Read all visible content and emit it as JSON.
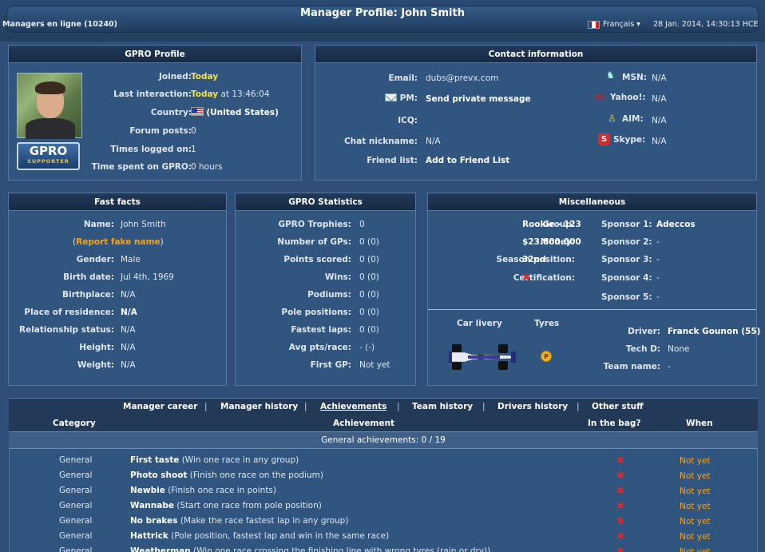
{
  "header": {
    "title": "Manager Profile: John Smith",
    "online": "Managers en ligne (10240)",
    "language": "Français ▾",
    "datetime": "28 Jan. 2014, 14:30:13 HCE",
    "colors": {
      "accent": "#f4e24a",
      "link": "#f6a21a",
      "bg": "#2f4f78"
    }
  },
  "profile": {
    "heading": "GPRO Profile",
    "badge_line1": "GPRO",
    "badge_line2": "SUPPORTER",
    "joined_label": "Joined:",
    "joined": "Today",
    "last_label": "Last interaction:",
    "last_day": "Today",
    "last_time": " at 13:46:04",
    "country_label": "Country:",
    "country": "(United States)",
    "posts_label": "Forum posts:",
    "posts": "0",
    "logged_label": "Times logged on:",
    "logged": "1",
    "spent_label": "Time spent on GPRO:",
    "spent": "0 hours"
  },
  "contact": {
    "heading": "Contact information",
    "email_label": "Email:",
    "email": "dubs@prevx.com",
    "pm_label": "PM:",
    "pm": "Send private message",
    "icq_label": "ICQ:",
    "icq": "",
    "chat_label": "Chat nickname:",
    "chat": "N/A",
    "friend_label": "Friend list:",
    "friend": "Add to Friend List",
    "msn_label": "MSN:",
    "msn": "N/A",
    "yahoo_label": "Yahoo!:",
    "yahoo": "N/A",
    "aim_label": "AIM:",
    "aim": "N/A",
    "skype_label": "Skype:",
    "skype": "N/A"
  },
  "facts": {
    "heading": "Fast facts",
    "name_label": "Name:",
    "name": "John Smith",
    "report_open": "(",
    "report": "Report fake name",
    "report_close": ")",
    "gender_label": "Gender:",
    "gender": "Male",
    "birth_label": "Birth date:",
    "birth": "Jul 4th, 1969",
    "birthplace_label": "Birthplace:",
    "birthplace": "N/A",
    "residence_label": "Place of residence:",
    "residence": "N/A",
    "relation_label": "Relationship status:",
    "relation": "N/A",
    "height_label": "Height:",
    "height": "N/A",
    "weight_label": "Weight:",
    "weight": "N/A"
  },
  "stats": {
    "heading": "GPRO Statistics",
    "trophies_label": "GPRO Trophies:",
    "trophies": "0",
    "gps_label": "Number of GPs:",
    "gps": "0 (0)",
    "points_label": "Points scored:",
    "points": "0 (0)",
    "wins_label": "Wins:",
    "wins": "0 (0)",
    "podiums_label": "Podiums:",
    "podiums": "0 (0)",
    "poles_label": "Pole positions:",
    "poles": "0 (0)",
    "fastest_label": "Fastest laps:",
    "fastest": "0 (0)",
    "avg_label": "Avg pts/race:",
    "avg": "- (-)",
    "firstgp_label": "First GP:",
    "firstgp": "Not yet"
  },
  "misc": {
    "heading": "Miscellaneous",
    "group_label": "Group:",
    "group": "Rookie - 123",
    "money_label": "Money:",
    "money": "$23.800.000",
    "season_label": "Season position:",
    "season": "32nd",
    "cert_label": "Certification:",
    "sp1_label": "Sponsor 1:",
    "sp1": "Adeccos",
    "sp2_label": "Sponsor 2:",
    "sp2": "-",
    "sp3_label": "Sponsor 3:",
    "sp3": "-",
    "sp4_label": "Sponsor 4:",
    "sp4": "-",
    "sp5_label": "Sponsor 5:",
    "sp5": "-",
    "livery_label": "Car livery",
    "tyres_label": "Tyres",
    "tyre_letter": "P",
    "driver_label": "Driver:",
    "driver": "Franck Gounon (55)",
    "techd_label": "Tech D:",
    "techd": "None",
    "team_label": "Team name:",
    "team": "-"
  },
  "tabs": {
    "career": "Manager career",
    "history": "Manager history",
    "achievements": "Achievements",
    "team_history": "Team history",
    "drivers_history": "Drivers history",
    "other": "Other stuff",
    "sep": "|"
  },
  "table": {
    "col_category": "Category",
    "col_achievement": "Achievement",
    "col_bag": "In the bag?",
    "col_when": "When",
    "section": "General achievements: 0 / 19",
    "rows": [
      {
        "cat": "General",
        "name": "First taste",
        "desc": " (Win one race in any group)",
        "when": "Not yet"
      },
      {
        "cat": "General",
        "name": "Photo shoot",
        "desc": " (Finish one race on the podium)",
        "when": "Not yet"
      },
      {
        "cat": "General",
        "name": "Newbie",
        "desc": " (Finish one race in points)",
        "when": "Not yet"
      },
      {
        "cat": "General",
        "name": "Wannabe",
        "desc": " (Start one race from pole position)",
        "when": "Not yet"
      },
      {
        "cat": "General",
        "name": "No brakes",
        "desc": " (Make the race fastest lap in any group)",
        "when": "Not yet"
      },
      {
        "cat": "General",
        "name": "Hattrick",
        "desc": " (Pole position, fastest lap and win in the same race)",
        "when": "Not yet"
      },
      {
        "cat": "General",
        "name": "Weatherman",
        "desc": " (Win one race crossing the finishing line with wrong tyres (rain or dry))",
        "when": "Not yet"
      }
    ],
    "bag_mark": "✖"
  }
}
